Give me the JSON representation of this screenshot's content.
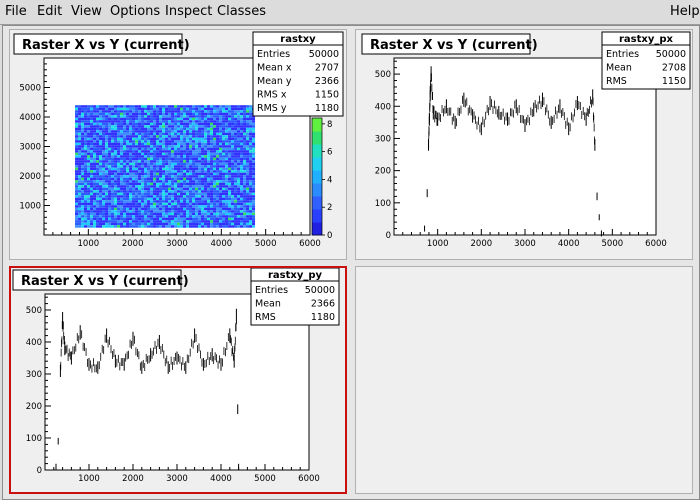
{
  "menu": {
    "file": "File",
    "edit": "Edit",
    "view": "View",
    "options": "Options",
    "inspect": "Inspect",
    "classes": "Classes",
    "help": "Help"
  },
  "pads": {
    "pad1": {
      "title": "Raster X vs Y (current)",
      "stats": {
        "name": "rastxy",
        "rows": [
          {
            "label": "Entries",
            "value": "50000"
          },
          {
            "label": "Mean x",
            "value": "2707"
          },
          {
            "label": "Mean y",
            "value": "2366"
          },
          {
            "label": "RMS x",
            "value": "1150"
          },
          {
            "label": "RMS y",
            "value": "1180"
          }
        ]
      },
      "palette_ticks": [
        "0",
        "2",
        "4",
        "6",
        "8"
      ]
    },
    "pad2": {
      "title": "Raster X vs Y (current)",
      "stats": {
        "name": "rastxy_px",
        "rows": [
          {
            "label": "Entries",
            "value": "50000"
          },
          {
            "label": "Mean",
            "value": "2708"
          },
          {
            "label": "RMS",
            "value": "1150"
          }
        ]
      }
    },
    "pad3": {
      "title": "Raster X vs Y (current)",
      "stats": {
        "name": "rastxy_py",
        "rows": [
          {
            "label": "Entries",
            "value": "50000"
          },
          {
            "label": "Mean",
            "value": "2366"
          },
          {
            "label": "RMS",
            "value": "1180"
          }
        ]
      }
    }
  },
  "chart_data": [
    {
      "type": "heatmap",
      "title": "Raster X vs Y (current)",
      "xlim": [
        0,
        6000
      ],
      "ylim": [
        0,
        6000
      ],
      "x_ticks": [
        "1000",
        "2000",
        "3000",
        "4000",
        "5000",
        "6000"
      ],
      "y_ticks": [
        "1000",
        "2000",
        "3000",
        "4000",
        "5000"
      ],
      "filled_region": {
        "x": [
          700,
          4700
        ],
        "y": [
          300,
          4400
        ]
      },
      "z_range": [
        0,
        8
      ],
      "colors": {
        "low": "#3030ff",
        "mid": "#20c8ff",
        "high": "#30e060"
      }
    },
    {
      "type": "scatter",
      "title": "Raster X vs Y (current)",
      "xlim": [
        0,
        6000
      ],
      "ylim": [
        0,
        550
      ],
      "x_ticks": [
        "1000",
        "2000",
        "3000",
        "4000",
        "5000",
        "6000"
      ],
      "y_ticks": [
        "0",
        "100",
        "200",
        "300",
        "400",
        "500"
      ],
      "x": [
        700,
        760,
        790,
        810,
        830,
        850,
        900,
        1000,
        1200,
        1400,
        1600,
        1800,
        2000,
        2200,
        2400,
        2600,
        2800,
        3000,
        3200,
        3400,
        3600,
        3800,
        4000,
        4200,
        4400,
        4550,
        4600,
        4650,
        4700,
        4750
      ],
      "y": [
        20,
        130,
        280,
        360,
        440,
        500,
        380,
        360,
        400,
        350,
        420,
        370,
        330,
        410,
        380,
        360,
        400,
        340,
        390,
        420,
        350,
        400,
        330,
        410,
        360,
        430,
        280,
        120,
        55,
        5
      ]
    },
    {
      "type": "scatter",
      "title": "Raster X vs Y (current)",
      "xlim": [
        0,
        6000
      ],
      "ylim": [
        0,
        550
      ],
      "x_ticks": [
        "1000",
        "2000",
        "3000",
        "4000",
        "5000",
        "6000"
      ],
      "y_ticks": [
        "0",
        "100",
        "200",
        "300",
        "400",
        "500"
      ],
      "x": [
        250,
        300,
        350,
        400,
        450,
        600,
        800,
        1000,
        1200,
        1400,
        1600,
        1800,
        2000,
        2200,
        2400,
        2600,
        2800,
        3000,
        3200,
        3400,
        3600,
        3800,
        4000,
        4200,
        4300,
        4350,
        4380,
        4400
      ],
      "y": [
        10,
        90,
        310,
        470,
        380,
        350,
        430,
        330,
        320,
        420,
        340,
        330,
        410,
        320,
        360,
        400,
        320,
        350,
        320,
        420,
        330,
        360,
        330,
        420,
        340,
        480,
        190,
        10
      ]
    }
  ]
}
